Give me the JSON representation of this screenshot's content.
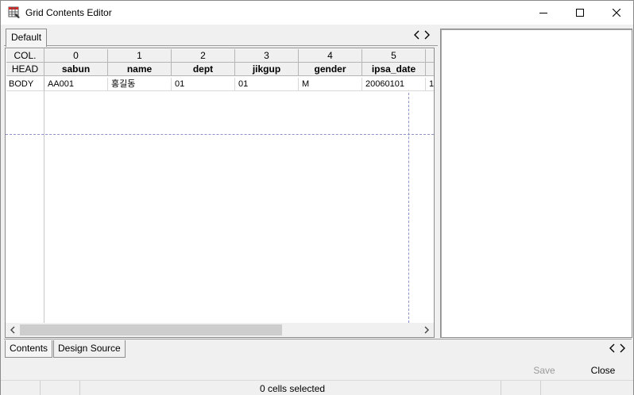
{
  "window": {
    "title": "Grid Contents Editor"
  },
  "top_tabs": [
    {
      "label": "Default"
    }
  ],
  "grid": {
    "row_headers": {
      "col": "COL.",
      "head": "HEAD",
      "body": "BODY"
    },
    "columns": [
      {
        "index": "0",
        "head": "sabun",
        "body": "AA001"
      },
      {
        "index": "1",
        "head": "name",
        "body": "홍길동"
      },
      {
        "index": "2",
        "head": "dept",
        "body": "01"
      },
      {
        "index": "3",
        "head": "jikgup",
        "body": "01"
      },
      {
        "index": "4",
        "head": "gender",
        "body": "M"
      },
      {
        "index": "5",
        "head": "ipsa_date",
        "body": "20060101"
      },
      {
        "index": "",
        "head": "",
        "body": "1"
      }
    ]
  },
  "bottom_tabs": [
    {
      "label": "Contents"
    },
    {
      "label": "Design Source"
    }
  ],
  "buttons": {
    "save": "Save",
    "close": "Close"
  },
  "status": {
    "text": "0 cells selected"
  },
  "colors": {
    "accent_icon": "#d62828",
    "dash_line": "#8b93c8",
    "disabled_text": "#9a9a9a"
  }
}
